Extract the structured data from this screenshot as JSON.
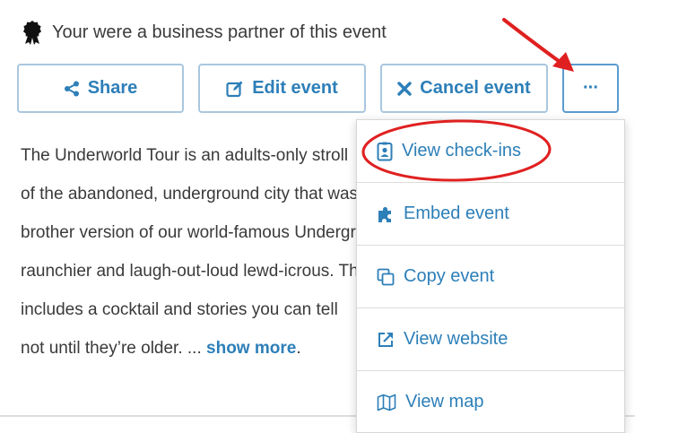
{
  "partner_notice": "Your were a business partner of this event",
  "buttons": {
    "share": "Share",
    "edit": "Edit event",
    "cancel": "Cancel event",
    "more": "···"
  },
  "description": {
    "lines": [
      "The Underworld Tour is an adults-only stroll",
      "of the abandoned, underground city that was",
      "brother version of our world-famous Underground",
      "raunchier and laugh-out-loud lewd-icrous. This",
      "includes a cocktail and stories you can tell",
      "not until they’re older. ... "
    ],
    "show_more": "show more",
    "end_punct": "."
  },
  "menu": {
    "items": [
      {
        "label": "View check-ins",
        "icon": "id-badge-icon"
      },
      {
        "label": "Embed event",
        "icon": "puzzle-icon"
      },
      {
        "label": "Copy event",
        "icon": "copy-icon"
      },
      {
        "label": "View website",
        "icon": "external-link-icon"
      },
      {
        "label": "View map",
        "icon": "map-icon"
      }
    ]
  },
  "colors": {
    "accent": "#2d7fb8",
    "button_border": "#a9c7df",
    "annotation_red": "#e02020"
  }
}
